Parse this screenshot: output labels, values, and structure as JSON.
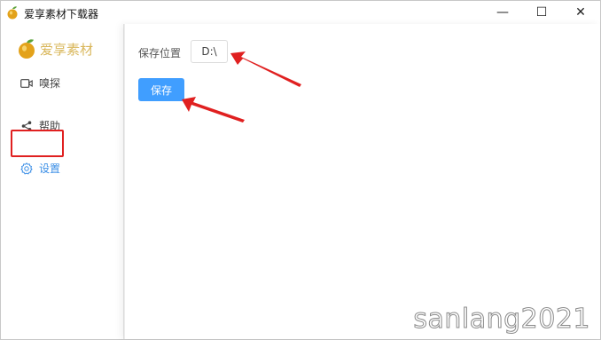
{
  "window": {
    "title": "爱享素材下载器",
    "controls": {
      "minimize": "—",
      "maximize": "☐",
      "close": "✕"
    }
  },
  "sidebar": {
    "brand": "爱享素材",
    "items": [
      {
        "label": "嗅探",
        "icon": "video-camera-icon",
        "active": false
      },
      {
        "label": "帮助",
        "icon": "share-icon",
        "active": false
      },
      {
        "label": "设置",
        "icon": "gear-icon",
        "active": true
      }
    ]
  },
  "settings": {
    "save_location_label": "保存位置",
    "save_location_value": "D:\\",
    "save_button_label": "保存"
  },
  "colors": {
    "accent": "#409eff",
    "active_nav": "#3a8ee6",
    "brand": "#d9b75b",
    "annotation_red": "#e02020"
  },
  "watermark": "sanlang2021"
}
